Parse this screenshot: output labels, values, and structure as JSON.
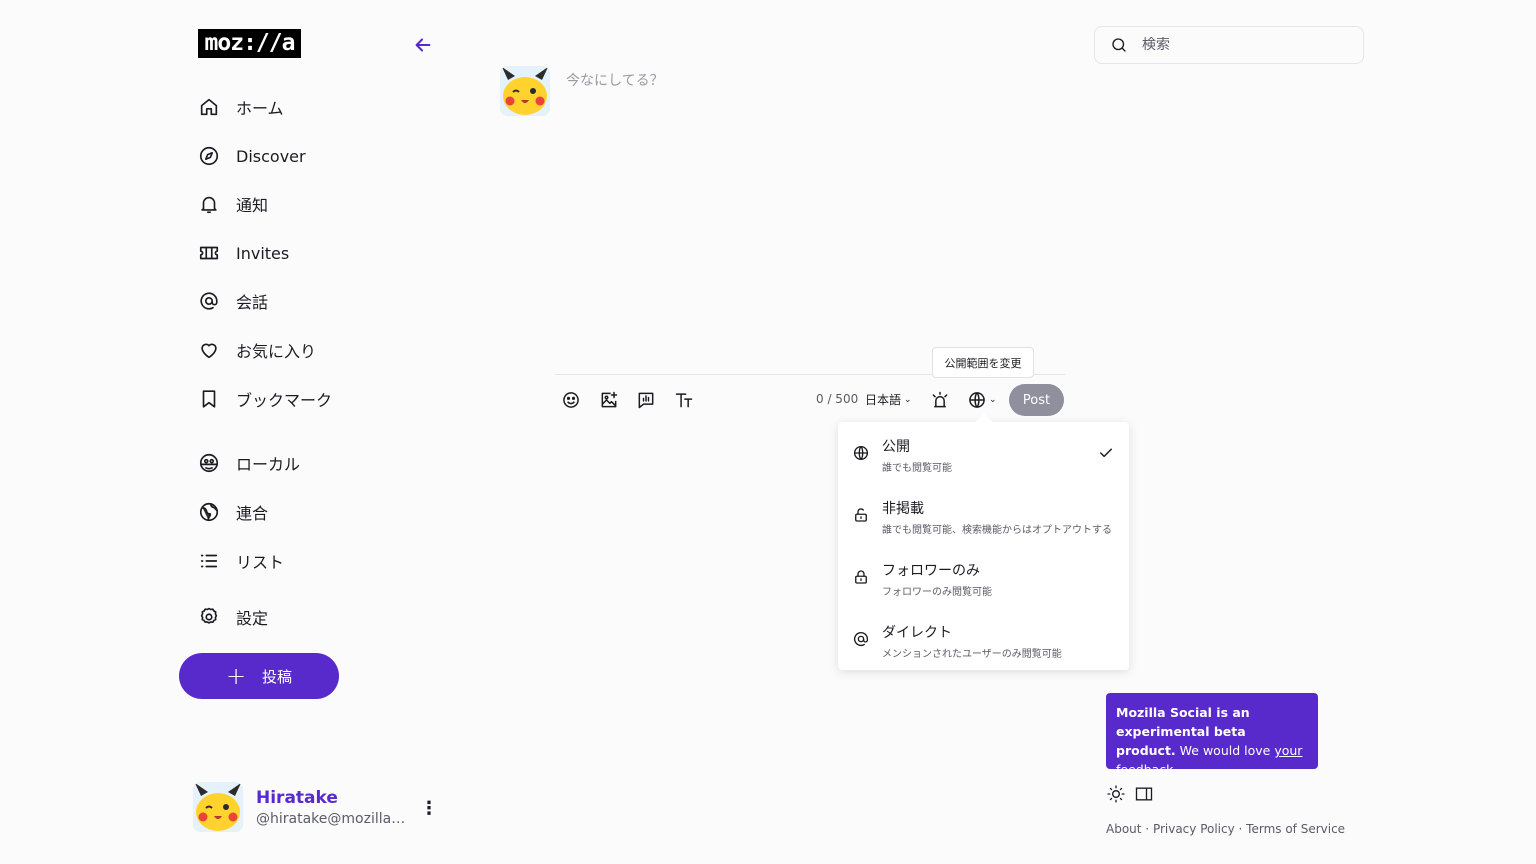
{
  "logo": {
    "text": "moz://a"
  },
  "nav": {
    "items": [
      {
        "label": "ホーム",
        "icon": "home-icon"
      },
      {
        "label": "Discover",
        "icon": "compass-icon"
      },
      {
        "label": "通知",
        "icon": "bell-icon"
      },
      {
        "label": "Invites",
        "icon": "ticket-icon"
      },
      {
        "label": "会話",
        "icon": "at-icon"
      },
      {
        "label": "お気に入り",
        "icon": "heart-icon"
      },
      {
        "label": "ブックマーク",
        "icon": "bookmark-icon"
      },
      {
        "label": "ローカル",
        "icon": "local-icon"
      },
      {
        "label": "連合",
        "icon": "federated-globe-icon"
      },
      {
        "label": "リスト",
        "icon": "list-icon"
      },
      {
        "label": "設定",
        "icon": "gear-icon"
      }
    ],
    "post_button": "投稿"
  },
  "account": {
    "name": "Hiratake",
    "handle": "@hiratake@mozilla.social"
  },
  "composer": {
    "placeholder": "今なにしてる？",
    "counter": "0 / 500",
    "language": "日本語",
    "submit": "Post",
    "tooltip": "公開範囲を変更"
  },
  "visibility_menu": {
    "options": [
      {
        "title": "公開",
        "desc": "誰でも閲覧可能",
        "icon": "globe-icon",
        "selected": true
      },
      {
        "title": "非掲載",
        "desc": "誰でも閲覧可能、検索機能からはオプトアウトする",
        "icon": "unlock-icon",
        "selected": false
      },
      {
        "title": "フォロワーのみ",
        "desc": "フォロワーのみ閲覧可能",
        "icon": "lock-icon",
        "selected": false
      },
      {
        "title": "ダイレクト",
        "desc": "メンションされたユーザーのみ閲覧可能",
        "icon": "at-icon",
        "selected": false
      }
    ]
  },
  "search": {
    "placeholder": "検索"
  },
  "beta": {
    "bold": "Mozilla Social is an experimental beta product.",
    "text": " We would love ",
    "link": "your feedback",
    "end": "."
  },
  "footer": {
    "about": "About",
    "sep": " · ",
    "privacy": "Privacy Policy",
    "terms": "Terms of Service"
  },
  "colors": {
    "accent": "#592acb",
    "text": "#1c1b22",
    "muted": "#5b5b66",
    "button_disabled": "#8f8f9d"
  }
}
